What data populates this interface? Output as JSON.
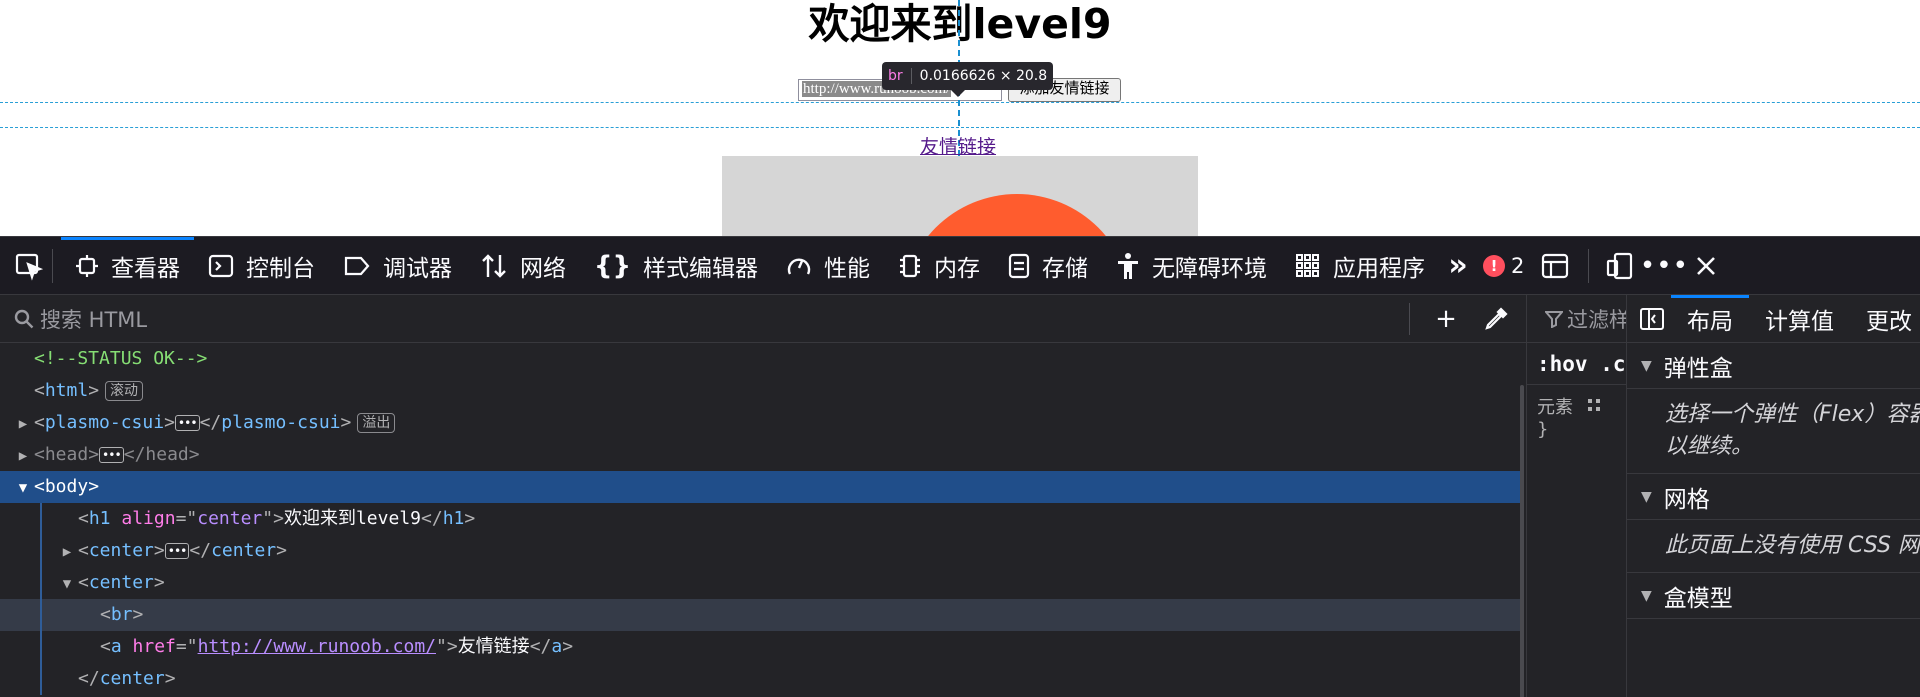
{
  "page": {
    "heading": "欢迎来到level9",
    "url_input_value": "http://www.runoob.com/",
    "add_link_button": "添加友情链接",
    "friend_link": "友情链接"
  },
  "tooltip": {
    "tag": "br",
    "dimensions": "0.0166626 × 20.8"
  },
  "toolbar": {
    "tabs": [
      {
        "label": "查看器",
        "icon": "inspector-icon",
        "active": true
      },
      {
        "label": "控制台",
        "icon": "console-icon"
      },
      {
        "label": "调试器",
        "icon": "debugger-icon"
      },
      {
        "label": "网络",
        "icon": "network-icon"
      },
      {
        "label": "样式编辑器",
        "icon": "style-editor-icon"
      },
      {
        "label": "性能",
        "icon": "performance-icon"
      },
      {
        "label": "内存",
        "icon": "memory-icon"
      },
      {
        "label": "存储",
        "icon": "storage-icon"
      },
      {
        "label": "无障碍环境",
        "icon": "accessibility-icon"
      },
      {
        "label": "应用程序",
        "icon": "application-icon"
      }
    ],
    "error_count": "2"
  },
  "inspector": {
    "search_placeholder": "搜索 HTML"
  },
  "tree": {
    "comment": "<!--STATUS OK-->",
    "html_tag": "html",
    "html_badge": "滚动",
    "plasmo_tag": "plasmo-csui",
    "plasmo_badge": "溢出",
    "head_tag": "head",
    "body_tag": "body",
    "h1_tag": "h1",
    "h1_attr": "align",
    "h1_attr_val": "center",
    "h1_text": "欢迎来到level9",
    "center_tag": "center",
    "br_tag": "br",
    "a_tag": "a",
    "a_attr": "href",
    "a_href": "http://www.runoob.com/",
    "a_text": "友情链接"
  },
  "rules": {
    "filter_placeholder": "过滤样式",
    "hov": ":hov",
    "cls": ".cls",
    "element_label": "元素",
    "brace": "}"
  },
  "layout": {
    "tabs": [
      "布局",
      "计算值",
      "更改"
    ],
    "flex_title": "弹性盒",
    "flex_body_1": "选择一个弹性（Flex）容器或项目以继续。",
    "flex_body_2": "以继续。",
    "grid_title": "网格",
    "grid_body": "此页面上没有使用 CSS 网格",
    "box_title": "盒模型"
  }
}
